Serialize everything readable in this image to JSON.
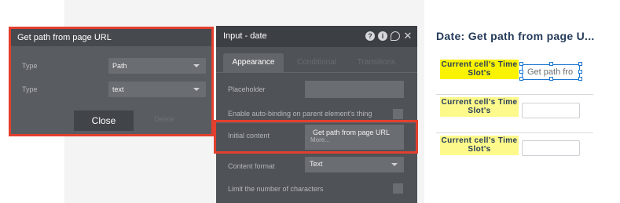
{
  "expression_popup": {
    "title": "Get path from page URL",
    "rows": [
      {
        "label": "Type",
        "value": "Path"
      },
      {
        "label": "Type",
        "value": "text"
      }
    ],
    "close_label": "Close",
    "delete_label": "Delete"
  },
  "property_editor": {
    "title": "Input - date",
    "tabs": [
      "Appearance",
      "Conditional",
      "Transitions"
    ],
    "placeholder_label": "Placeholder",
    "autobinding_label": "Enable auto-binding on parent element's thing",
    "initial_content_label": "Initial content",
    "initial_content_value": "Get path from page URL",
    "initial_content_more": "More...",
    "content_format_label": "Content format",
    "content_format_value": "Text",
    "limit_chars_label": "Limit the number of characters"
  },
  "page_preview": {
    "title": "Date: Get path from page U...",
    "rows": [
      {
        "cell_label": "Current cell's Time Slot's",
        "input_value": "Get path fro"
      },
      {
        "cell_label": "Current cell's Time Slot's",
        "input_value": ""
      },
      {
        "cell_label": "Current cell's Time Slot's",
        "input_value": ""
      }
    ]
  },
  "colors": {
    "highlight_red": "#e23f2e",
    "editor_bg": "#4f5257",
    "cell_yellow": "#f9f200",
    "title_navy": "#253b59",
    "selection_blue": "#1976d2"
  }
}
